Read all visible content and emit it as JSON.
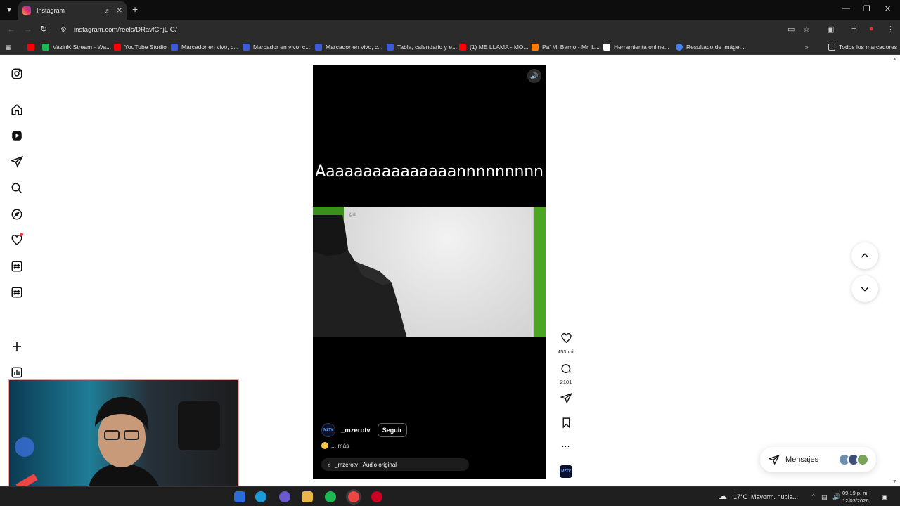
{
  "browser": {
    "tab_title": "Instagram",
    "url": "instagram.com/reels/DRavfCnjLIG/",
    "bookmarks": [
      {
        "label": "VazinK Stream - Wa...",
        "color": "#1db954"
      },
      {
        "label": "YouTube Studio",
        "color": "#ff0000"
      },
      {
        "label": "Marcador en vivo, c...",
        "color": "#3b5bdb"
      },
      {
        "label": "Marcador en vivo, c...",
        "color": "#3b5bdb"
      },
      {
        "label": "Marcador en vivo, c...",
        "color": "#3b5bdb"
      },
      {
        "label": "Tabla, calendario y e...",
        "color": "#3b5bdb"
      },
      {
        "label": "(1) ME LLAMA - MO...",
        "color": "#ff0000"
      },
      {
        "label": "Pa' Mi Barrio - Mr. L...",
        "color": "#ff7a00"
      },
      {
        "label": "Herramienta online...",
        "color": "#ffffff"
      },
      {
        "label": "Resultado de imáge...",
        "color": "#4285f4"
      }
    ],
    "all_bookmarks_label": "Todos los marcadores"
  },
  "sidebar": {
    "icons": [
      "instagram-logo-icon",
      "home-icon",
      "reels-icon",
      "send-icon",
      "search-icon",
      "explore-icon",
      "heart-icon",
      "threads-icon",
      "threads-icon-2",
      "create-icon",
      "stats-icon"
    ]
  },
  "reel": {
    "caption_text": "Aaaaaaaaaaaaaaannnnnnnnn",
    "board_note": "ga",
    "author": "_mzerotv",
    "author_avatar_text": "MZTV",
    "follow_label": "Seguir",
    "more_label": "... más",
    "audio_label": "_mzerotv · Audio original",
    "likes": "453 mil",
    "comments": "2101"
  },
  "messages": {
    "label": "Mensajes"
  },
  "taskbar": {
    "weather": "17°C",
    "weather_desc": "Mayorm. nubla...",
    "time": "09:19 p. m.",
    "date": "12/03/2026"
  },
  "colors": {
    "accent": "#e1306c",
    "green_screen": "#4aa623",
    "notif": "#ff3040"
  }
}
